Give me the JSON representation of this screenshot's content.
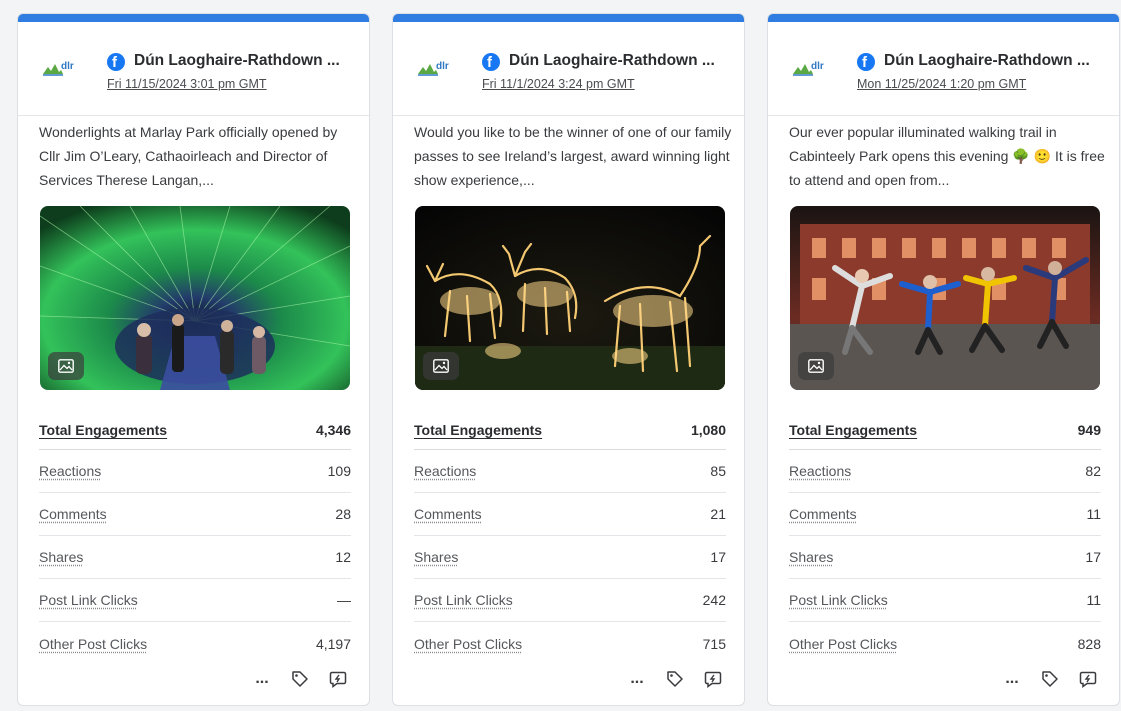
{
  "posts": [
    {
      "logo_text": "dlr",
      "page_name": "Dún Laoghaire-Rathdown ...",
      "date": "Fri 11/15/2024 3:01 pm GMT",
      "text": "Wonderlights at Marlay Park officially opened by Cllr Jim O’Leary, Cathaoirleach and Director of Services Therese Langan,...",
      "metrics": {
        "total_engagements": {
          "label": "Total Engagements",
          "value": "4,346"
        },
        "reactions": {
          "label": "Reactions",
          "value": "109"
        },
        "comments": {
          "label": "Comments",
          "value": "28"
        },
        "shares": {
          "label": "Shares",
          "value": "12"
        },
        "post_link_clicks": {
          "label": "Post Link Clicks",
          "value": "—"
        },
        "other_post_clicks": {
          "label": "Other Post Clicks",
          "value": "4,197"
        }
      },
      "more_label": "..."
    },
    {
      "logo_text": "dlr",
      "page_name": "Dún Laoghaire-Rathdown ...",
      "date": "Fri 11/1/2024 3:24 pm GMT",
      "text": "Would you like to be the winner of one of our family passes to see Ireland’s largest, award winning light show experience,...",
      "metrics": {
        "total_engagements": {
          "label": "Total Engagements",
          "value": "1,080"
        },
        "reactions": {
          "label": "Reactions",
          "value": "85"
        },
        "comments": {
          "label": "Comments",
          "value": "21"
        },
        "shares": {
          "label": "Shares",
          "value": "17"
        },
        "post_link_clicks": {
          "label": "Post Link Clicks",
          "value": "242"
        },
        "other_post_clicks": {
          "label": "Other Post Clicks",
          "value": "715"
        }
      },
      "more_label": "..."
    },
    {
      "logo_text": "dlr",
      "page_name": "Dún Laoghaire-Rathdown ...",
      "date": "Mon 11/25/2024 1:20 pm GMT",
      "text": "Our ever popular illuminated walking trail in Cabinteely Park opens this evening 🌳 🙂 It is free to attend and open from...",
      "metrics": {
        "total_engagements": {
          "label": "Total Engagements",
          "value": "949"
        },
        "reactions": {
          "label": "Reactions",
          "value": "82"
        },
        "comments": {
          "label": "Comments",
          "value": "11"
        },
        "shares": {
          "label": "Shares",
          "value": "17"
        },
        "post_link_clicks": {
          "label": "Post Link Clicks",
          "value": "11"
        },
        "other_post_clicks": {
          "label": "Other Post Clicks",
          "value": "828"
        }
      },
      "more_label": "..."
    }
  ],
  "icons": {
    "network": "facebook-icon",
    "image_badge": "image-icon",
    "tag": "tag-icon",
    "reply": "reply-icon",
    "more": "more-icon"
  },
  "colors": {
    "accent": "#2f7de1",
    "facebook": "#1877f2"
  }
}
